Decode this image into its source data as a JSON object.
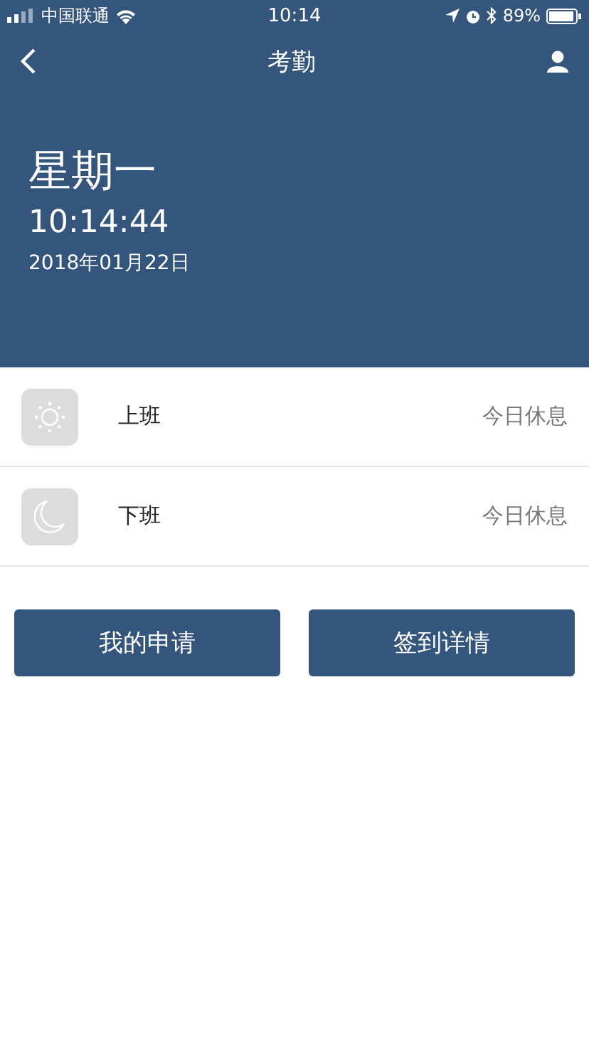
{
  "status_bar": {
    "carrier": "中国联通",
    "time": "10:14",
    "battery": "89%"
  },
  "nav": {
    "title": "考勤"
  },
  "summary": {
    "weekday": "星期一",
    "time": "10:14:44",
    "date": "2018年01月22日"
  },
  "shifts": [
    {
      "kind": "sun",
      "label": "上班",
      "status": "今日休息"
    },
    {
      "kind": "moon",
      "label": "下班",
      "status": "今日休息"
    }
  ],
  "buttons": [
    "我的申请",
    "签到详情"
  ]
}
